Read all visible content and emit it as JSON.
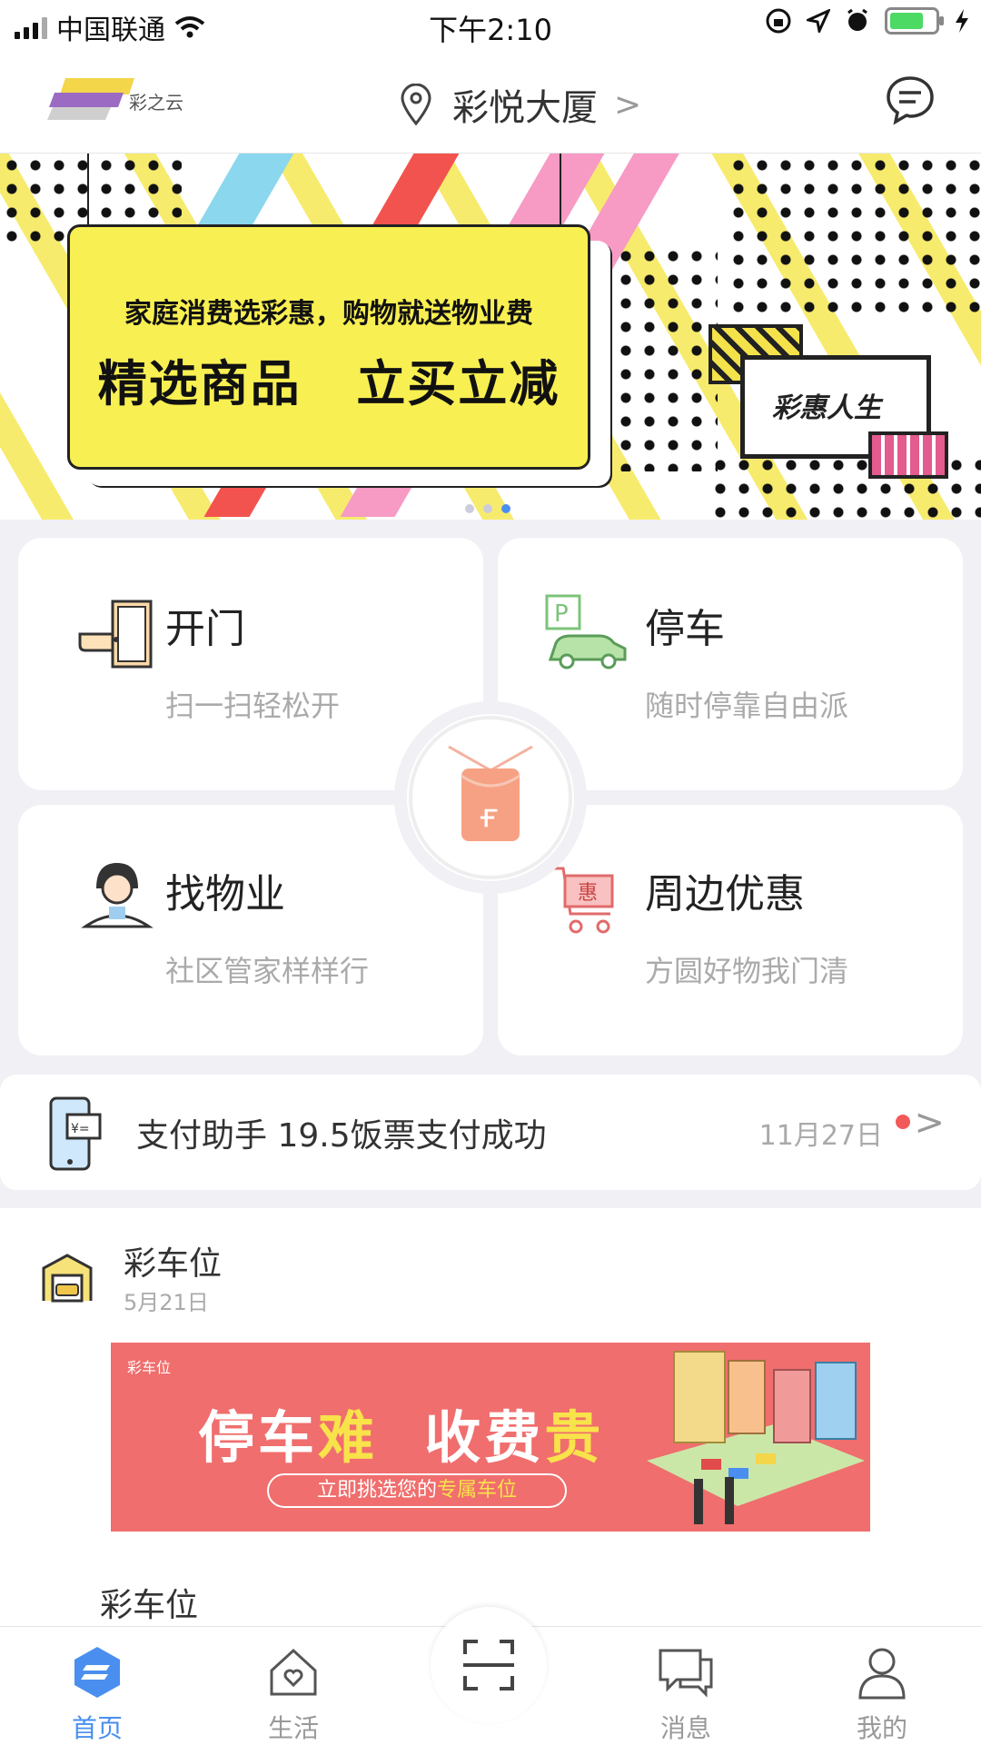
{
  "status_bar": {
    "carrier": "中国联通",
    "time": "下午2:10",
    "battery_level": 0.8
  },
  "header": {
    "logo_text": "彩之云",
    "location": "彩悦大厦",
    "location_chevron": ">"
  },
  "banner": {
    "line1": "家庭消费选彩惠，购物就送物业费",
    "line2": "精选商品  立买立减",
    "tag_text": "彩惠人生",
    "page_count": 3,
    "active_page": 3
  },
  "services": [
    {
      "title": "开门",
      "subtitle": "扫一扫轻松开",
      "icon": "door-icon"
    },
    {
      "title": "停车",
      "subtitle": "随时停靠自由派",
      "icon": "parking-car-icon"
    },
    {
      "title": "找物业",
      "subtitle": "社区管家样样行",
      "icon": "property-staff-icon"
    },
    {
      "title": "周边优惠",
      "subtitle": "方圆好物我门清",
      "icon": "shopping-cart-icon"
    }
  ],
  "center_badge": {
    "icon": "red-envelope-icon",
    "glyph": "ғ"
  },
  "notice": {
    "text": "支付助手 19.5饭票支付成功",
    "date": "11月27日",
    "chevron": ">"
  },
  "feed": {
    "title": "彩车位",
    "date": "5月21日",
    "ad": {
      "brand": "彩车位",
      "headline_a": "停车",
      "headline_b": "难",
      "headline_c": "收费",
      "headline_d": "贵",
      "cta_a": "立即挑选您的",
      "cta_b": "专属车位"
    },
    "next_title": "彩车位"
  },
  "tabbar": {
    "tabs": [
      {
        "label": "首页",
        "icon": "home-logo-icon",
        "active": true
      },
      {
        "label": "生活",
        "icon": "house-heart-icon",
        "active": false
      },
      {
        "label": "",
        "icon": "scan-icon",
        "active": false
      },
      {
        "label": "消息",
        "icon": "chat-icon",
        "active": false
      },
      {
        "label": "我的",
        "icon": "person-icon",
        "active": false
      }
    ]
  },
  "colors": {
    "accent_blue": "#4a8ff0",
    "banner_yellow": "#f8ef52",
    "ad_red": "#f06e6e",
    "notice_dot": "#f25a5a"
  }
}
